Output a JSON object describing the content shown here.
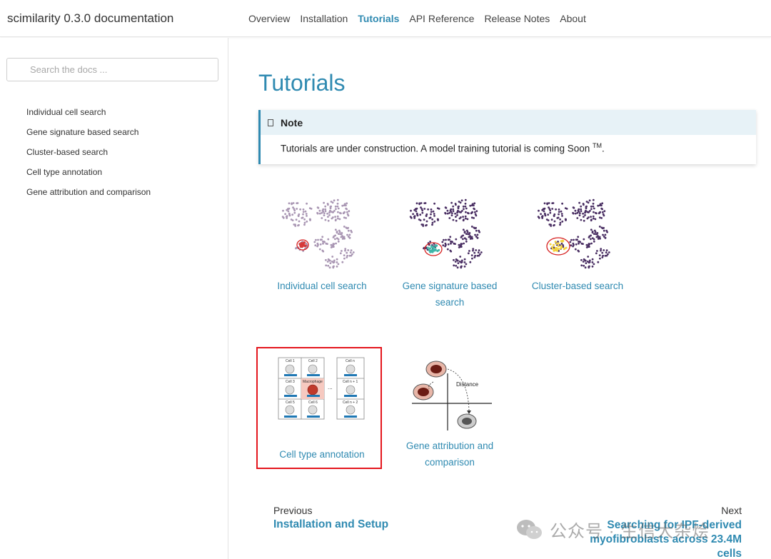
{
  "navbar": {
    "brand": "scimilarity 0.3.0 documentation",
    "links": [
      "Overview",
      "Installation",
      "Tutorials",
      "API Reference",
      "Release Notes",
      "About"
    ],
    "active_index": 2
  },
  "sidebar": {
    "search_placeholder": "Search the docs ...",
    "items": [
      "Individual cell search",
      "Gene signature based search",
      "Cluster-based search",
      "Cell type annotation",
      "Gene attribution and comparison"
    ]
  },
  "main": {
    "title": "Tutorials",
    "note": {
      "heading": "Note",
      "text": "Tutorials are under construction. A model training tutorial is coming Soon",
      "sup": "TM",
      "suffix": "."
    },
    "cards": [
      {
        "label": "Individual cell search",
        "thumb": "scatter-red-ring"
      },
      {
        "label": "Gene signature based search",
        "thumb": "scatter-teal-ring"
      },
      {
        "label": "Cluster-based search",
        "thumb": "scatter-yellow-ring"
      },
      {
        "label": "Cell type annotation",
        "thumb": "cell-grid",
        "highlighted": true
      },
      {
        "label": "Gene attribution and comparison",
        "thumb": "distance-diagram"
      }
    ],
    "thumb_text": {
      "grid_cells": [
        "Cell 1",
        "Cell 2",
        "Cell 3",
        "Macrophage",
        "Cell 5",
        "Cell 6"
      ],
      "grid_right": [
        "Cell n",
        "Cell n + 1",
        "Cell n + 2"
      ],
      "ellipsis": "...",
      "distance": "Distance"
    },
    "pager": {
      "prev_caption": "Previous",
      "prev_label": "Installation and Setup",
      "next_caption": "Next",
      "next_label": "Searching for IPF-derived myofibroblasts across 23.4M cells"
    },
    "watermark": "公众号 · 生信大杂烩"
  },
  "colors": {
    "accent": "#2f8ab1",
    "note_bg": "#e7f2f7",
    "highlight": "#e4161d"
  }
}
